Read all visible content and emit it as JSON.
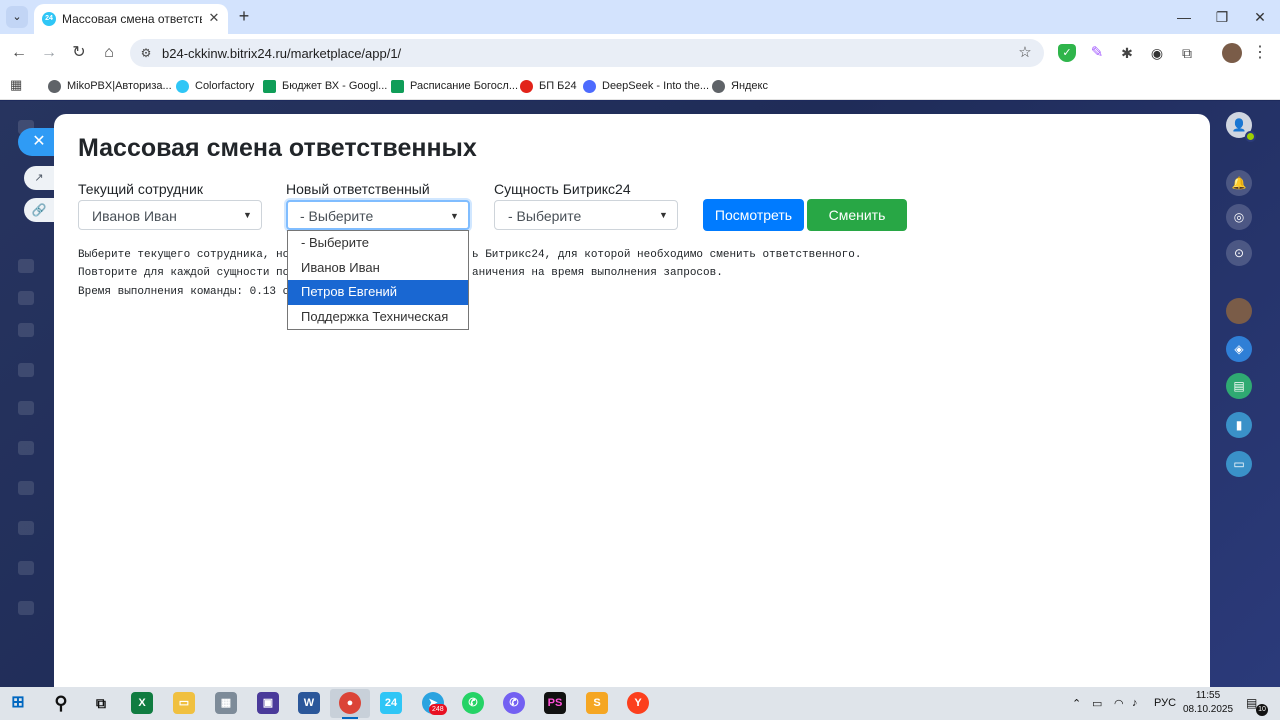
{
  "browser": {
    "tab_title": "Массовая смена ответственных",
    "tab_favicon_text": "24",
    "new_tab_label": "+",
    "url": "b24-ckkinw.bitrix24.ru/marketplace/app/1/",
    "bookmarks": [
      {
        "label": "MikoPBX|Авторизa...",
        "icon": "globe-icon",
        "color": "#5f6368"
      },
      {
        "label": "Colorfactory",
        "icon": "bitrix24-icon",
        "color": "#2fc6f6"
      },
      {
        "label": "Бюджет ВХ - Googl...",
        "icon": "sheets-icon",
        "color": "#0f9d58"
      },
      {
        "label": "Расписание Богосл...",
        "icon": "sheets-icon",
        "color": "#0f9d58"
      },
      {
        "label": "БП Б24",
        "icon": "bp-icon",
        "color": "#e2231a"
      },
      {
        "label": "DeepSeek - Into the...",
        "icon": "deepseek-icon",
        "color": "#4d6bfe"
      },
      {
        "label": "Яндекс",
        "icon": "globe-icon",
        "color": "#5f6368"
      }
    ]
  },
  "app": {
    "title": "Массовая смена ответственных",
    "fields": {
      "current_employee": {
        "label": "Текущий сотрудник",
        "value": "Иванов Иван"
      },
      "new_responsible": {
        "label": "Новый ответственный",
        "value": "- Выберите"
      },
      "entity": {
        "label": "Сущность Битрикс24",
        "value": "- Выберите"
      }
    },
    "buttons": {
      "view": "Посмотреть",
      "change": "Сменить"
    },
    "dropdown_options": [
      "- Выберите",
      "Иванов Иван",
      "Петров Евгений",
      "Поддержка Техническая"
    ],
    "dropdown_highlighted": "Петров Евгений",
    "info_lines": [
      "Выберите текущего сотрудника, нов",
      "ь Битрикс24, для которой необходимо сменить ответственного.",
      "Повторите для каждой сущности пос",
      "аничения на время выполнения запросов.",
      "Время выполнения команды: 0.13 се"
    ]
  },
  "taskbar": {
    "telegram_badge": "248",
    "language": "РУС",
    "time": "11:55",
    "date": "08.10.2025",
    "notifications": "10"
  }
}
